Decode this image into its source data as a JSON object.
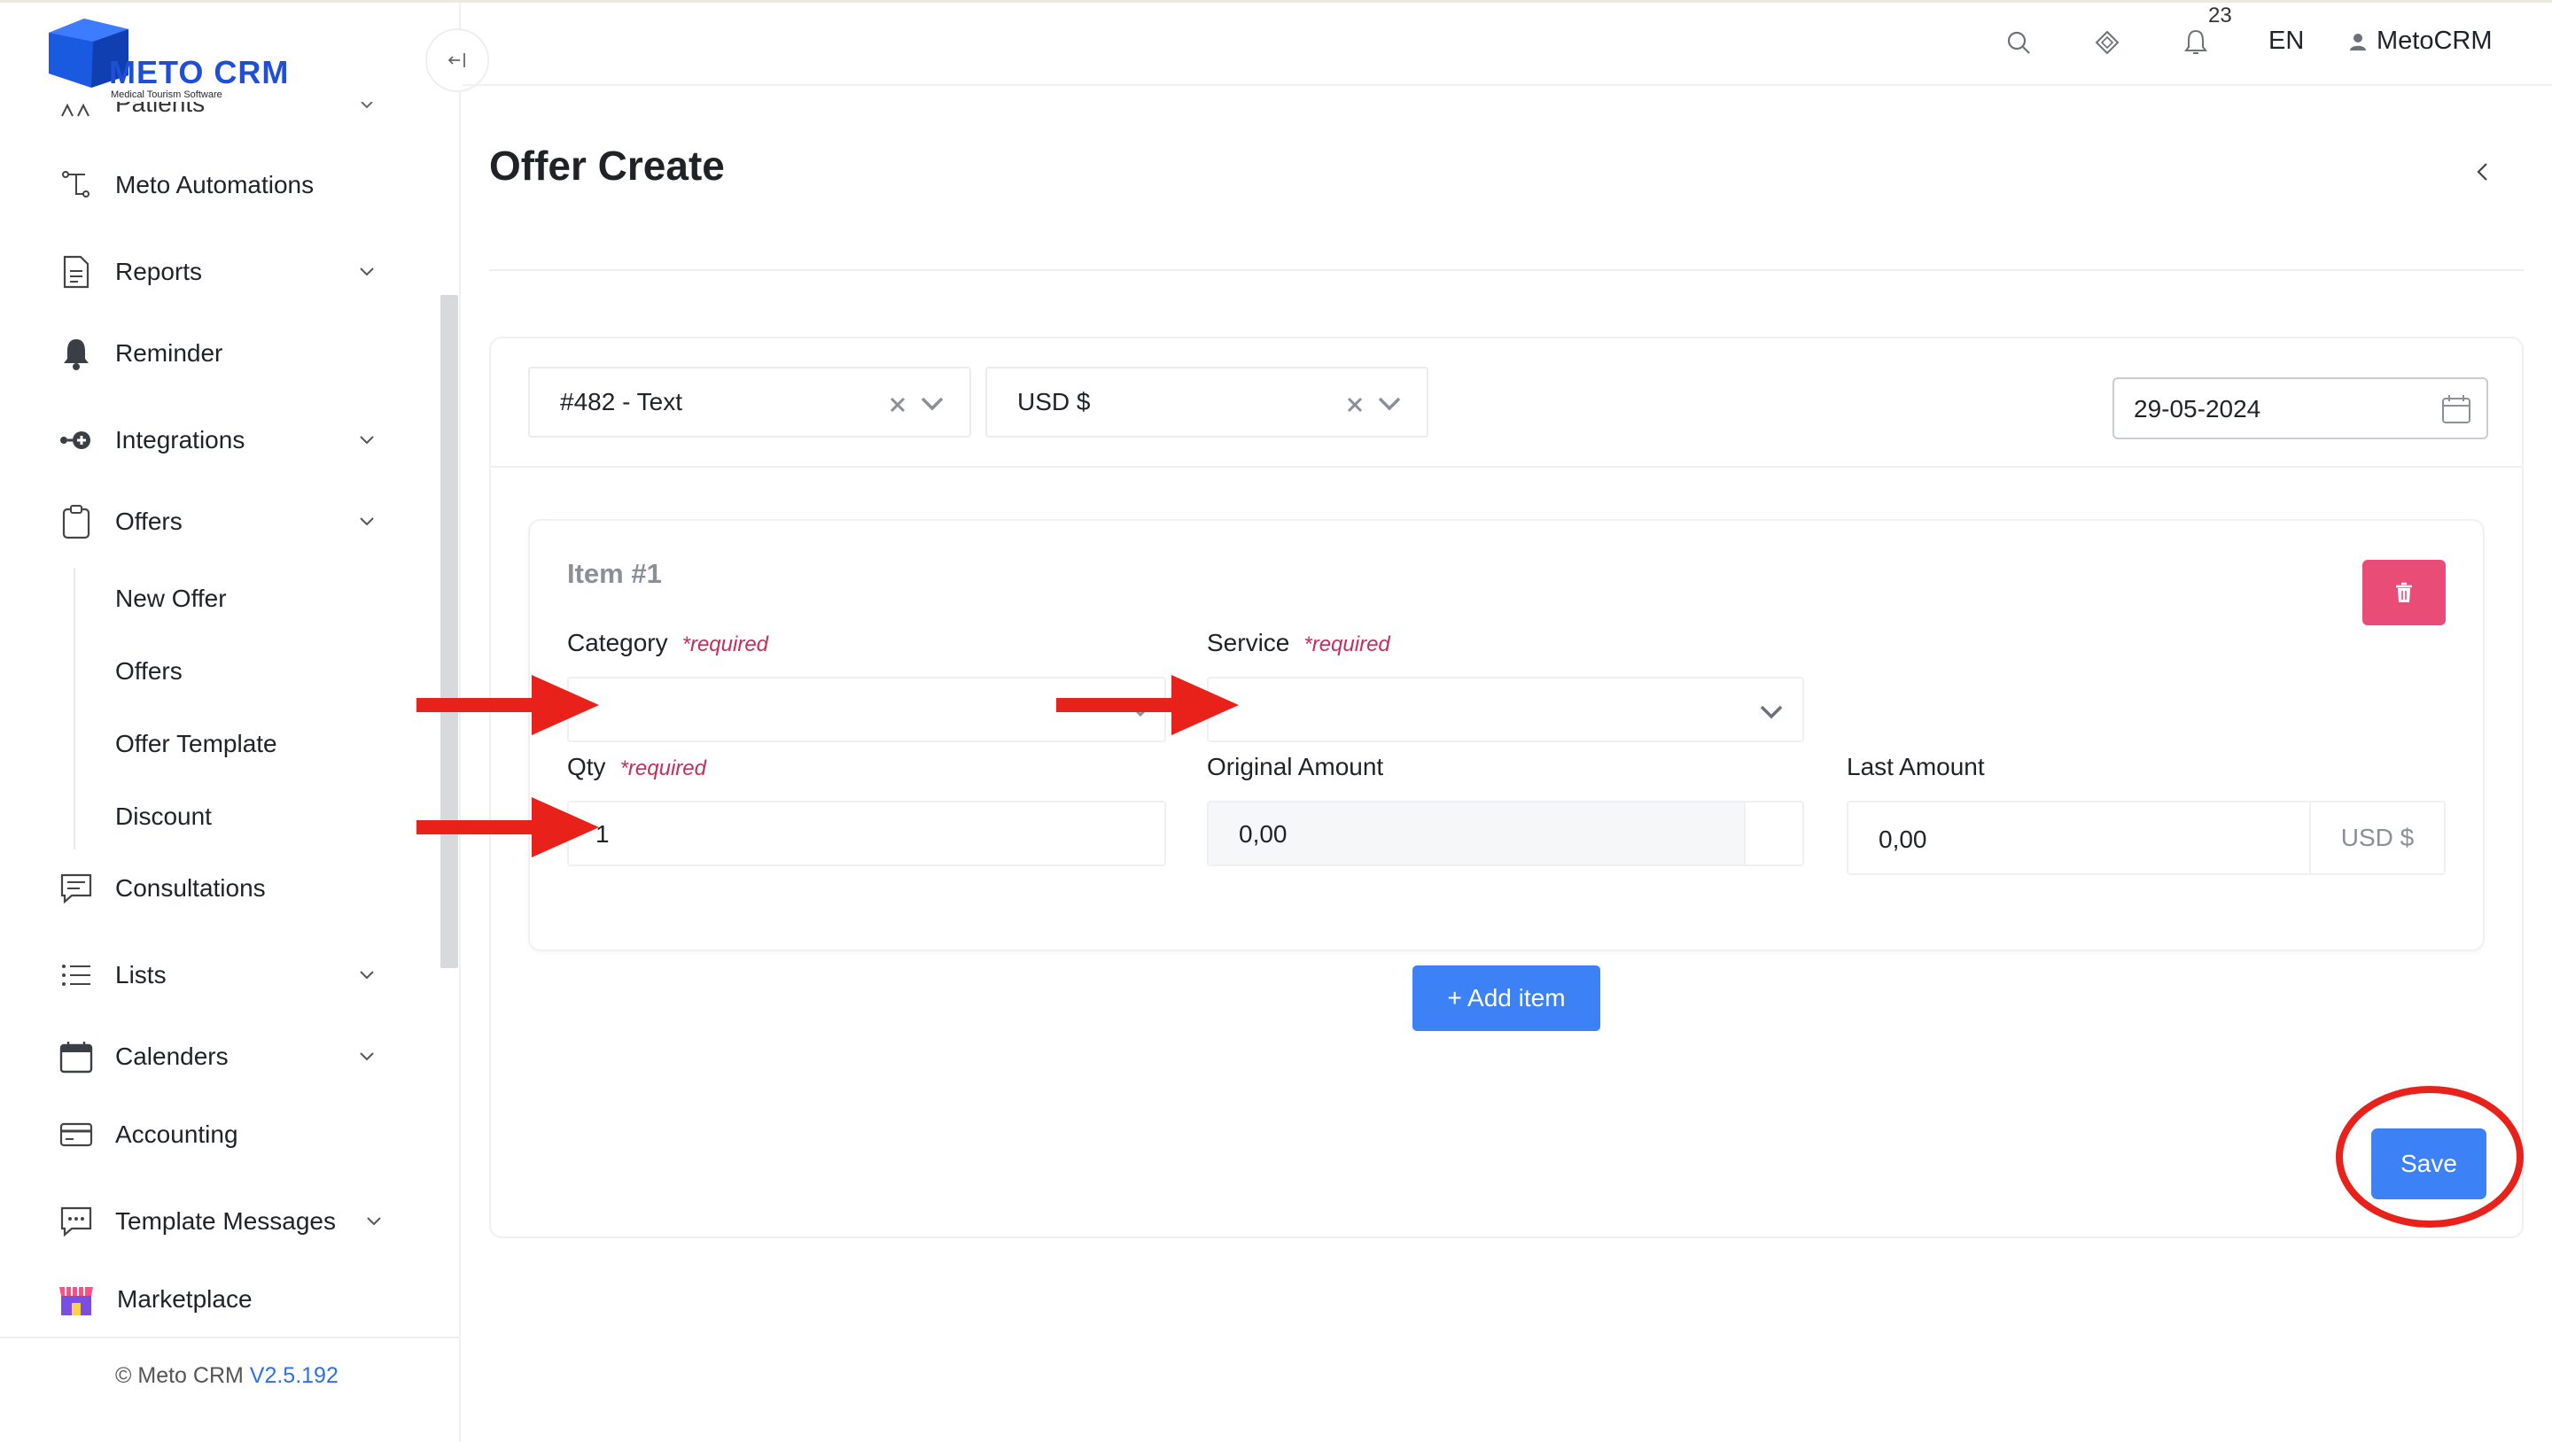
{
  "brand": {
    "name": "METO CRM",
    "tagline": "Medical Tourism Software"
  },
  "sidebar": {
    "partial_item": "Patients",
    "items": [
      {
        "label": "Meto Automations",
        "icon": "automation-icon"
      },
      {
        "label": "Reports",
        "icon": "document-icon"
      },
      {
        "label": "Reminder",
        "icon": "bell-icon"
      },
      {
        "label": "Integrations",
        "icon": "integrations-icon"
      },
      {
        "label": "Offers",
        "icon": "clipboard-icon"
      },
      {
        "label": "Consultations",
        "icon": "chat-icon"
      },
      {
        "label": "Lists",
        "icon": "list-icon"
      },
      {
        "label": "Calenders",
        "icon": "calendar-icon"
      },
      {
        "label": "Accounting",
        "icon": "card-icon"
      },
      {
        "label": "Template Messages",
        "icon": "message-icon"
      },
      {
        "label": "Marketplace",
        "icon": "store-icon"
      }
    ],
    "offers_sub": [
      "New Offer",
      "Offers",
      "Offer Template",
      "Discount"
    ],
    "footer": {
      "text": "© Meto CRM ",
      "version": "V2.5.192"
    }
  },
  "header": {
    "notification_count": "23",
    "language": "EN",
    "user": "MetoCRM"
  },
  "page": {
    "title": "Offer Create"
  },
  "form": {
    "patient_select": "#482 - Text",
    "currency_select": "USD $",
    "date": "29-05-2024",
    "item": {
      "title": "Item #1",
      "category_label": "Category",
      "service_label": "Service",
      "qty_label": "Qty",
      "required": "*required",
      "qty_value": "1",
      "original_amount_label": "Original Amount",
      "original_amount_value": "0,00",
      "last_amount_label": "Last Amount",
      "last_amount_value": "0,00",
      "last_amount_currency": "USD $"
    },
    "add_item_label": "+ Add item",
    "save_label": "Save"
  },
  "colors": {
    "primary": "#3c82f6",
    "danger": "#ea4c78",
    "annotation": "#e8221b",
    "brand": "#1f4fd8"
  }
}
